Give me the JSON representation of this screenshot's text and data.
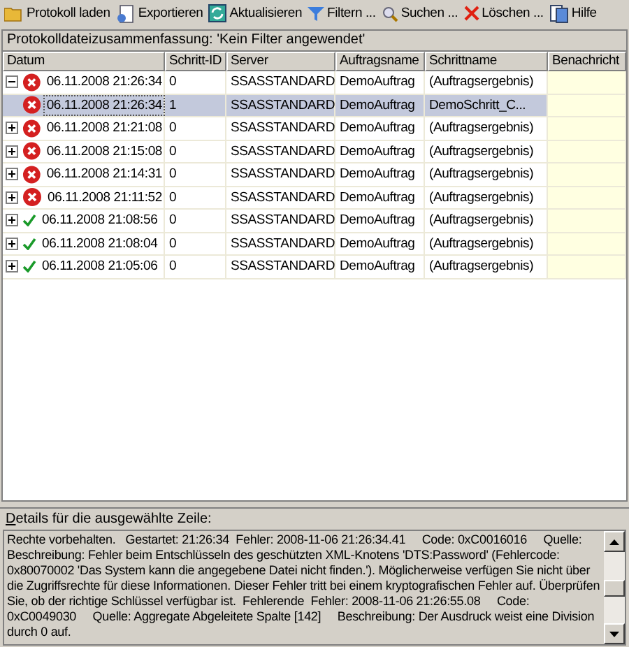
{
  "toolbar": [
    {
      "label": "Protokoll laden"
    },
    {
      "label": "Exportieren"
    },
    {
      "label": "Aktualisieren"
    },
    {
      "label": "Filtern ..."
    },
    {
      "label": "Suchen ..."
    },
    {
      "label": "Löschen ..."
    },
    {
      "label": "Hilfe"
    }
  ],
  "summary": "Protokolldateizusammenfassung: 'Kein Filter angewendet'",
  "table": {
    "columns": [
      "Datum",
      "Schritt-ID",
      "Server",
      "Auftragsname",
      "Schrittname",
      "Benachricht"
    ],
    "rows": [
      {
        "kind": "error",
        "expanded": true,
        "selected": false,
        "date": "06.11.2008 21:26:34",
        "step_id": "0",
        "server": "SSASSTANDARD",
        "job": "DemoAuftrag",
        "step": "(Auftragsergebnis)",
        "children": [
          {
            "kind": "error",
            "selected": true,
            "date": "06.11.2008 21:26:34",
            "step_id": "1",
            "server": "SSASSTANDARD",
            "job": "DemoAuftrag",
            "step": "DemoSchritt_C..."
          }
        ]
      },
      {
        "kind": "error",
        "expanded": false,
        "selected": false,
        "date": "06.11.2008 21:21:08",
        "step_id": "0",
        "server": "SSASSTANDARD",
        "job": "DemoAuftrag",
        "step": "(Auftragsergebnis)"
      },
      {
        "kind": "error",
        "expanded": false,
        "selected": false,
        "date": "06.11.2008 21:15:08",
        "step_id": "0",
        "server": "SSASSTANDARD",
        "job": "DemoAuftrag",
        "step": "(Auftragsergebnis)"
      },
      {
        "kind": "error",
        "expanded": false,
        "selected": false,
        "date": "06.11.2008 21:14:31",
        "step_id": "0",
        "server": "SSASSTANDARD",
        "job": "DemoAuftrag",
        "step": "(Auftragsergebnis)"
      },
      {
        "kind": "error",
        "expanded": false,
        "selected": false,
        "date": "06.11.2008 21:11:52",
        "step_id": "0",
        "server": "SSASSTANDARD",
        "job": "DemoAuftrag",
        "step": "(Auftragsergebnis)"
      },
      {
        "kind": "success",
        "expanded": false,
        "selected": false,
        "date": "06.11.2008 21:08:56",
        "step_id": "0",
        "server": "SSASSTANDARD",
        "job": "DemoAuftrag",
        "step": "(Auftragsergebnis)"
      },
      {
        "kind": "success",
        "expanded": false,
        "selected": false,
        "date": "06.11.2008 21:08:04",
        "step_id": "0",
        "server": "SSASSTANDARD",
        "job": "DemoAuftrag",
        "step": "(Auftragsergebnis)"
      },
      {
        "kind": "success",
        "expanded": false,
        "selected": false,
        "date": "06.11.2008 21:05:06",
        "step_id": "0",
        "server": "SSASSTANDARD",
        "job": "DemoAuftrag",
        "step": "(Auftragsergebnis)"
      }
    ]
  },
  "details": {
    "label": "Details für die ausgewählte Zeile:",
    "text": "Rechte vorbehalten.   Gestartet: 21:26:34  Fehler: 2008-11-06 21:26:34.41     Code: 0xC0016016     Quelle:     Beschreibung: Fehler beim Entschlüsseln des geschützten XML-Knotens 'DTS:Password' (Fehlercode: 0x80070002 'Das System kann die angegebene Datei nicht finden.'). Möglicherweise verfügen Sie nicht über die Zugriffsrechte für diese Informationen. Dieser Fehler tritt bei einem kryptografischen Fehler auf. Überprüfen Sie, ob der richtige Schlüssel verfügbar ist.  Fehlerende  Fehler: 2008-11-06 21:26:55.08     Code: 0xC0049030     Quelle: Aggregate Abgeleitete Spalte [142]     Beschreibung: Der Ausdruck weist eine Division durch 0 auf."
  }
}
